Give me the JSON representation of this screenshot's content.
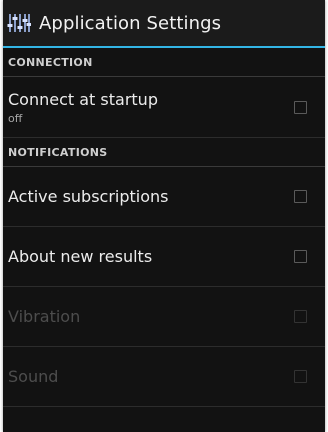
{
  "action_bar": {
    "title": "Application Settings",
    "icon": "equalizer-sliders-icon"
  },
  "categories": {
    "connection": "CONNECTION",
    "notifications": "NOTIFICATIONS"
  },
  "prefs": [
    {
      "title": "Connect at startup",
      "summary": "off",
      "checked": false,
      "enabled": true
    },
    {
      "title": "Active subscriptions",
      "summary": "",
      "checked": false,
      "enabled": true
    },
    {
      "title": "About new results",
      "summary": "",
      "checked": false,
      "enabled": true
    },
    {
      "title": "Vibration",
      "summary": "",
      "checked": false,
      "enabled": false
    },
    {
      "title": "Sound",
      "summary": "",
      "checked": false,
      "enabled": false
    }
  ],
  "colors": {
    "accent": "#33b5e5",
    "background": "#121212"
  }
}
